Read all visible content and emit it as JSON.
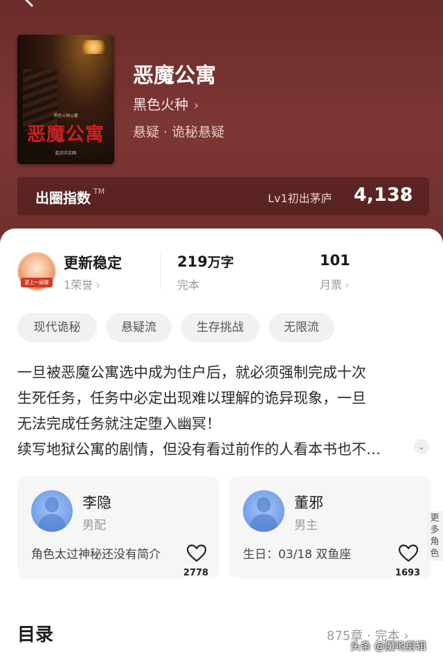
{
  "book": {
    "title": "恶魔公寓",
    "author": "黑色火种",
    "author_chevron": "›",
    "genre": "悬疑 · 诡秘悬疑",
    "cover": {
      "title": "恶魔公寓",
      "author_line": "黑色火种◎著",
      "publisher": "起点中文网"
    }
  },
  "popularity_index": {
    "label": "出圈指数",
    "tm": "TM",
    "level": "Lv1初出茅庐",
    "score": "4,138",
    "chevron": "›"
  },
  "stats": {
    "badge_ribbon": "更上一层楼",
    "update": {
      "title": "更新稳定",
      "sub": "1荣誉"
    },
    "words": {
      "value": "219",
      "unit": "万字",
      "sub": "完本"
    },
    "monthly_ticket": {
      "value": "101",
      "sub": "月票"
    }
  },
  "tags": [
    "现代诡秘",
    "悬疑流",
    "生存挑战",
    "无限流"
  ],
  "synopsis": {
    "lines": [
      "一旦被恶魔公寓选中成为住户后，就必须强制完成十次",
      "生死任务，任务中必定出现难以理解的诡异现象，一旦",
      "无法完成任务就注定堕入幽冥！",
      "续写地狱公寓的剧情，但没有看过前作的人看本书也不…"
    ],
    "expand_icon": "chevron-down-icon"
  },
  "characters": [
    {
      "name": "李隐",
      "role": "男配",
      "desc": "角色太过神秘还没有简介",
      "likes": "2778"
    },
    {
      "name": "董邪",
      "role": "男主",
      "desc": "生日：03/18 双鱼座",
      "likes": "1693"
    }
  ],
  "more_roles": "更多角色",
  "toc": {
    "title": "目录",
    "meta": "875章 · 完本 ›"
  },
  "watermark": "头条 @魔哟剪辑",
  "colors": {
    "header_bg": "#7d3634",
    "tag_bg": "#f1f1f1",
    "avatar": "#7aa5ea"
  }
}
